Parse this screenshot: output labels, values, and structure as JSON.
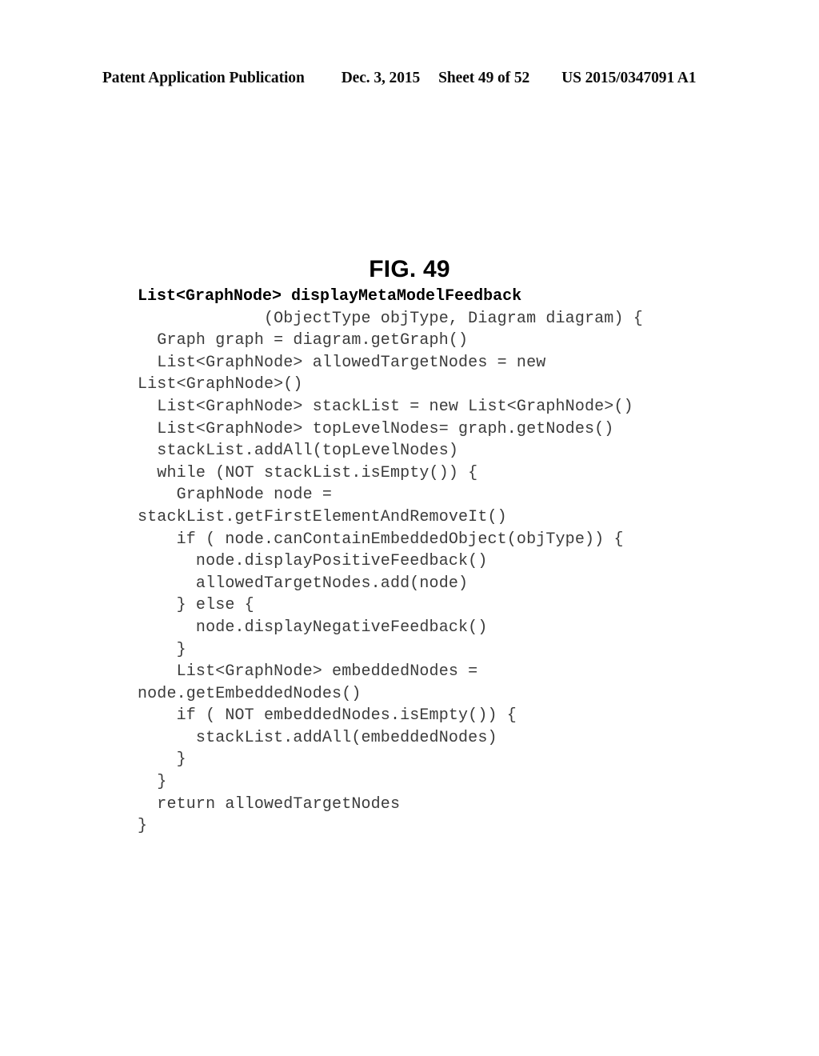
{
  "header": {
    "publication": "Patent Application Publication",
    "date": "Dec. 3, 2015",
    "sheet": "Sheet 49 of 52",
    "patent_number": "US 2015/0347091 A1"
  },
  "figure": {
    "title": "FIG. 49"
  },
  "code": {
    "language": "pseudocode",
    "lines": [
      "List<GraphNode> displayMetaModelFeedback",
      "             (ObjectType objType, Diagram diagram) {",
      "  Graph graph = diagram.getGraph()",
      "  List<GraphNode> allowedTargetNodes = new",
      "List<GraphNode>()",
      "  List<GraphNode> stackList = new List<GraphNode>()",
      "  List<GraphNode> topLevelNodes= graph.getNodes()",
      "  stackList.addAll(topLevelNodes)",
      "  while (NOT stackList.isEmpty()) {",
      "    GraphNode node =",
      "stackList.getFirstElementAndRemoveIt()",
      "    if ( node.canContainEmbeddedObject(objType)) {",
      "      node.displayPositiveFeedback()",
      "      allowedTargetNodes.add(node)",
      "    } else {",
      "      node.displayNegativeFeedback()",
      "    }",
      "    List<GraphNode> embeddedNodes =",
      "node.getEmbeddedNodes()",
      "    if ( NOT embeddedNodes.isEmpty()) {",
      "      stackList.addAll(embeddedNodes)",
      "    }",
      "  }",
      "  return allowedTargetNodes",
      "}"
    ]
  },
  "colors": {
    "page_background": "#ffffff",
    "header_text": "#0b0b0b",
    "title_text": "#000000",
    "code_text": "#3b3b3b",
    "code_signature_text": "#000000"
  }
}
